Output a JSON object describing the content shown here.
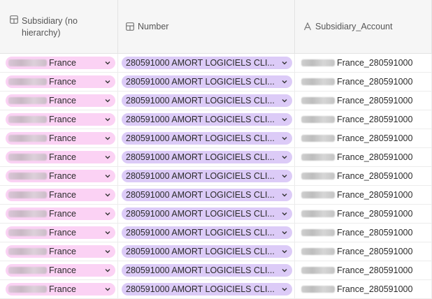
{
  "columns": [
    {
      "label": "Subsidiary (no hierarchy)",
      "icon": "table-icon"
    },
    {
      "label": "Number",
      "icon": "table-icon"
    },
    {
      "label": "Subsidiary_Account",
      "icon": "text-type-icon"
    }
  ],
  "colors": {
    "pink_pill": "#fbd2f4",
    "purple_pill": "#dccbf7"
  },
  "rows": [
    {
      "subsidiary": "France",
      "number": "280591000 AMORT LOGICIELS CLI...",
      "account": "France_280591000"
    },
    {
      "subsidiary": "France",
      "number": "280591000 AMORT LOGICIELS CLI...",
      "account": "France_280591000"
    },
    {
      "subsidiary": "France",
      "number": "280591000 AMORT LOGICIELS CLI...",
      "account": "France_280591000"
    },
    {
      "subsidiary": "France",
      "number": "280591000 AMORT LOGICIELS CLI...",
      "account": "France_280591000"
    },
    {
      "subsidiary": "France",
      "number": "280591000 AMORT LOGICIELS CLI...",
      "account": "France_280591000"
    },
    {
      "subsidiary": "France",
      "number": "280591000 AMORT LOGICIELS CLI...",
      "account": "France_280591000"
    },
    {
      "subsidiary": "France",
      "number": "280591000 AMORT LOGICIELS CLI...",
      "account": "France_280591000"
    },
    {
      "subsidiary": "France",
      "number": "280591000 AMORT LOGICIELS CLI...",
      "account": "France_280591000"
    },
    {
      "subsidiary": "France",
      "number": "280591000 AMORT LOGICIELS CLI...",
      "account": "France_280591000"
    },
    {
      "subsidiary": "France",
      "number": "280591000 AMORT LOGICIELS CLI...",
      "account": "France_280591000"
    },
    {
      "subsidiary": "France",
      "number": "280591000 AMORT LOGICIELS CLI...",
      "account": "France_280591000"
    },
    {
      "subsidiary": "France",
      "number": "280591000 AMORT LOGICIELS CLI...",
      "account": "France_280591000"
    },
    {
      "subsidiary": "France",
      "number": "280591000 AMORT LOGICIELS CLI...",
      "account": "France_280591000"
    }
  ]
}
